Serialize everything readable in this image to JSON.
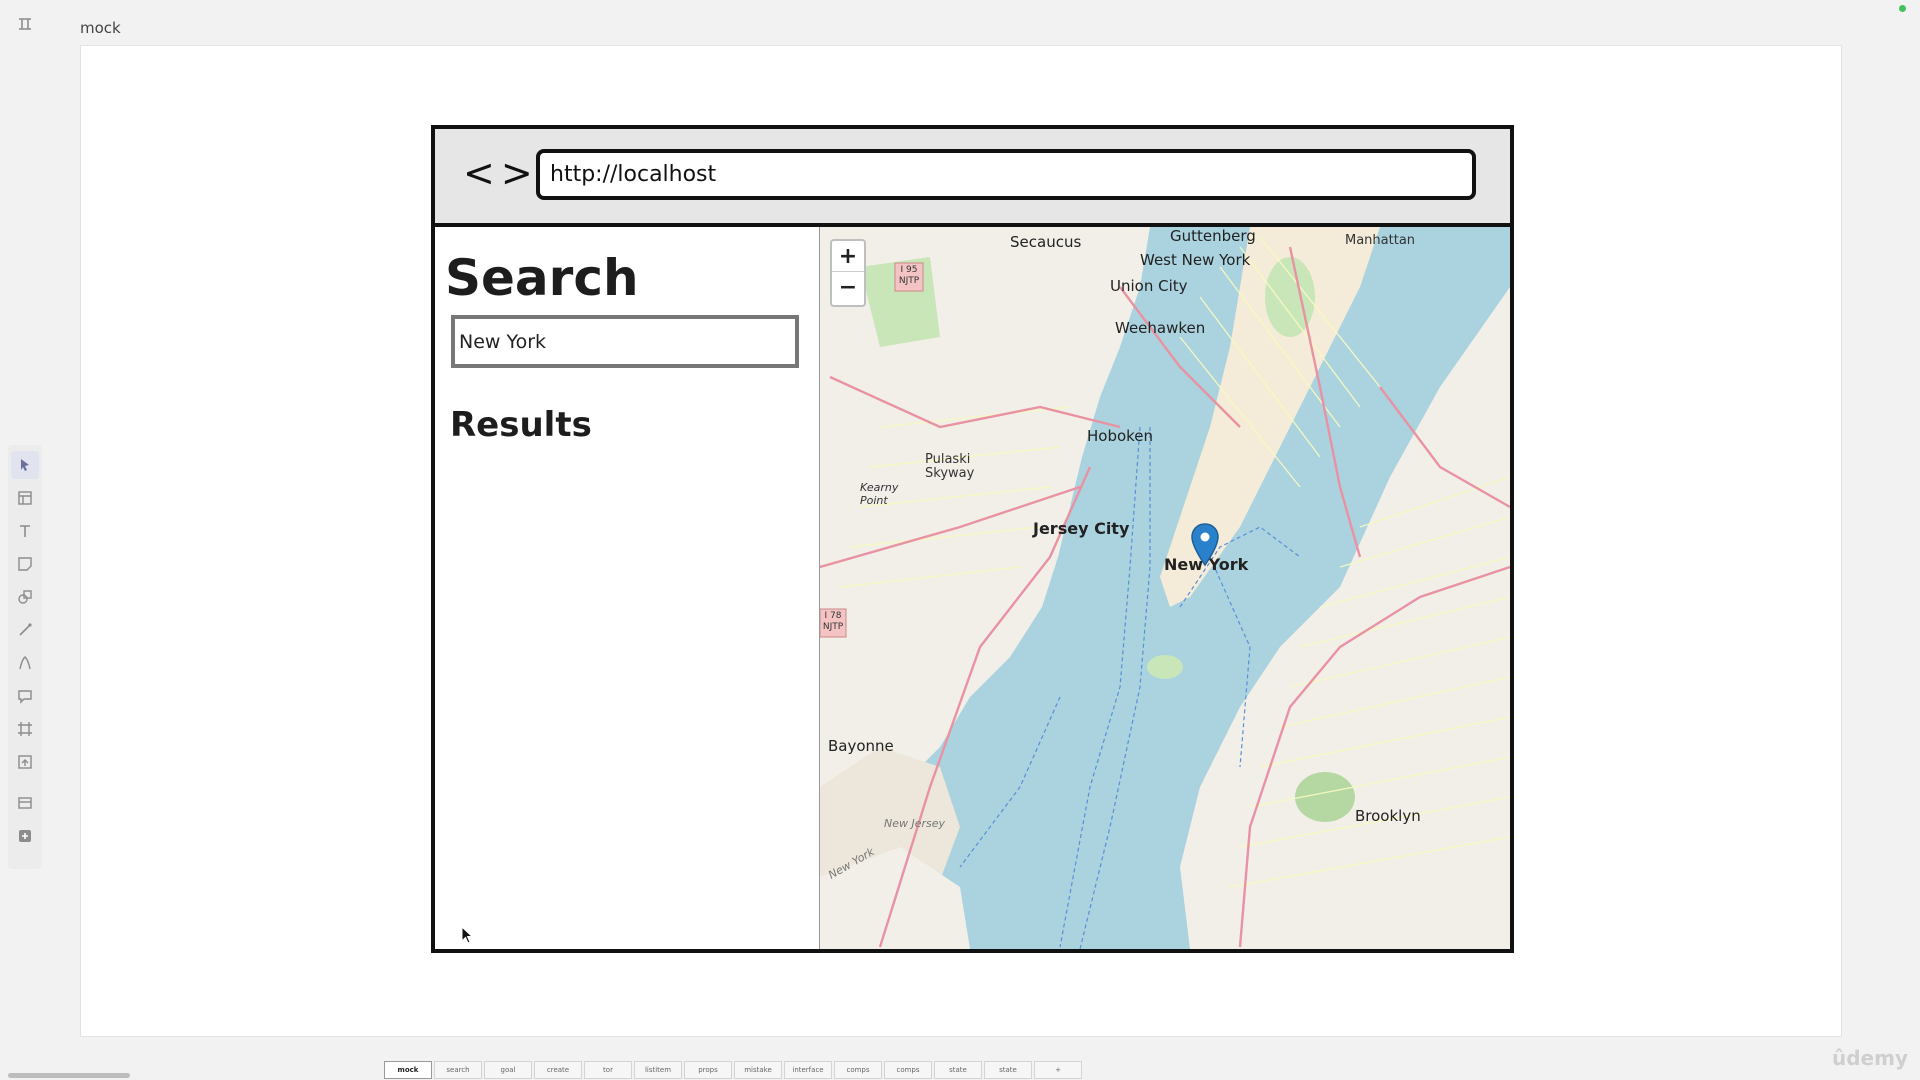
{
  "frame": {
    "label": "mock"
  },
  "browser": {
    "back_glyph": "<",
    "forward_glyph": ">",
    "url": "http://localhost"
  },
  "sidebar": {
    "title": "Search",
    "search_value": "New York",
    "results_title": "Results"
  },
  "map": {
    "zoom_in": "+",
    "zoom_out": "−",
    "labels": {
      "secaucus": "Secaucus",
      "guttenberg": "Guttenberg",
      "manhattan": "Manhattan",
      "west_new_york": "West New York",
      "union_city": "Union City",
      "weehawken": "Weehawken",
      "hoboken": "Hoboken",
      "pulaski": "Pulaski Skyway",
      "kearny": "Kearny Point",
      "jersey_city": "Jersey City",
      "new_york": "New York",
      "bayonne": "Bayonne",
      "brooklyn": "Brooklyn",
      "new_jersey": "New Jersey",
      "new_york_water": "New York",
      "i95": "I 95 NJTP",
      "i78": "I 78 NJTP"
    },
    "colors": {
      "water": "#aad3df",
      "land": "#f2efe9",
      "park": "#c8e6b8",
      "road_major": "#e892a2",
      "road_minor": "#f7fabf"
    }
  },
  "pages": {
    "tabs": [
      "mock",
      "search",
      "goal",
      "create",
      "tor",
      "listitem",
      "props",
      "mistake",
      "interface",
      "comps",
      "comps",
      "state",
      "state",
      "+"
    ],
    "active": "mock"
  },
  "watermark": "ûdemy"
}
